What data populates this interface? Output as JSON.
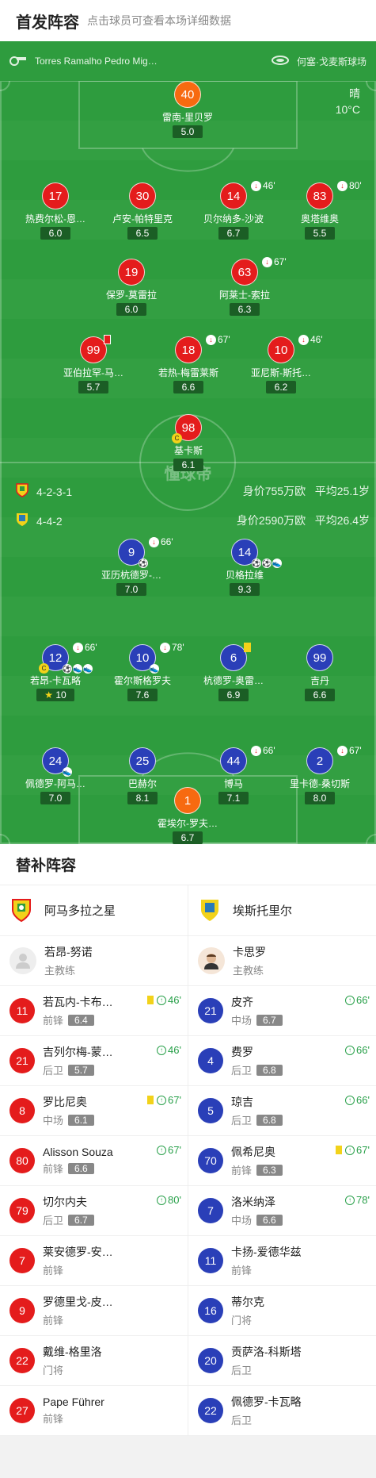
{
  "header": {
    "title": "首发阵容",
    "hint": "点击球员可查看本场详细数据"
  },
  "pitch": {
    "referee": "Torres Ramalho Pedro Mig…",
    "stadium": "何塞·戈麦斯球场",
    "weather": "晴",
    "temperature": "10°C",
    "watermark": "懂球帝",
    "home_formation": "4-2-3-1",
    "home_value": "身价755万欧",
    "home_age": "平均25.1岁",
    "away_formation": "4-4-2",
    "away_value": "身价2590万欧",
    "away_age": "平均26.4岁",
    "home_players": [
      {
        "num": "40",
        "name": "雷南-里贝罗",
        "rating": "5.0"
      },
      {
        "num": "17",
        "name": "热费尔松-恩…",
        "rating": "6.0"
      },
      {
        "num": "30",
        "name": "卢安-帕特里克",
        "rating": "6.5"
      },
      {
        "num": "14",
        "name": "贝尔纳多-沙波",
        "rating": "6.7",
        "sub": "46'"
      },
      {
        "num": "83",
        "name": "奥塔维奥",
        "rating": "5.5",
        "sub": "80'"
      },
      {
        "num": "19",
        "name": "保罗-莫雷拉",
        "rating": "6.0"
      },
      {
        "num": "63",
        "name": "阿莱士-索拉",
        "rating": "6.3",
        "sub": "67'"
      },
      {
        "num": "99",
        "name": "亚伯拉罕-马…",
        "rating": "5.7"
      },
      {
        "num": "18",
        "name": "若热-梅雷莱斯",
        "rating": "6.6",
        "sub": "67'"
      },
      {
        "num": "10",
        "name": "亚尼斯-斯托…",
        "rating": "6.2",
        "sub": "46'"
      },
      {
        "num": "98",
        "name": "基卡斯",
        "rating": "6.1"
      }
    ],
    "away_players": [
      {
        "num": "9",
        "name": "亚历杭德罗-…",
        "rating": "7.0",
        "sub": "66'"
      },
      {
        "num": "14",
        "name": "贝格拉维",
        "rating": "9.3"
      },
      {
        "num": "12",
        "name": "若昂-卡瓦略",
        "rating": "10",
        "sub": "66'"
      },
      {
        "num": "10",
        "name": "霍尔斯格罗夫",
        "rating": "7.6",
        "sub": "78'"
      },
      {
        "num": "6",
        "name": "杭德罗-奥雷…",
        "rating": "6.9"
      },
      {
        "num": "99",
        "name": "吉丹",
        "rating": "6.6"
      },
      {
        "num": "24",
        "name": "佩德罗-阿马…",
        "rating": "7.0"
      },
      {
        "num": "25",
        "name": "巴赫尔",
        "rating": "8.1"
      },
      {
        "num": "44",
        "name": "博马",
        "rating": "7.1",
        "sub": "66'"
      },
      {
        "num": "2",
        "name": "里卡德-桑切斯",
        "rating": "8.0",
        "sub": "67'"
      },
      {
        "num": "1",
        "name": "霍埃尔-罗夫…",
        "rating": "6.7"
      }
    ]
  },
  "subs": {
    "title": "替补阵容",
    "home": {
      "team": "阿马多拉之星",
      "coach": {
        "name": "若昂-努诺",
        "role": "主教练"
      },
      "players": [
        {
          "num": "11",
          "name": "若瓦内-卡布…",
          "pos": "前锋",
          "rating": "6.4",
          "sub": "46'",
          "yellow": true
        },
        {
          "num": "21",
          "name": "吉列尔梅-蒙…",
          "pos": "后卫",
          "rating": "5.7",
          "sub": "46'"
        },
        {
          "num": "8",
          "name": "罗比尼奥",
          "pos": "中场",
          "rating": "6.1",
          "sub": "67'",
          "yellow": true
        },
        {
          "num": "80",
          "name": "Alisson Souza",
          "pos": "前锋",
          "rating": "6.6",
          "sub": "67'"
        },
        {
          "num": "79",
          "name": "切尔内夫",
          "pos": "后卫",
          "rating": "6.7",
          "sub": "80'"
        },
        {
          "num": "7",
          "name": "莱安德罗-安…",
          "pos": "前锋"
        },
        {
          "num": "9",
          "name": "罗德里戈-皮…",
          "pos": "前锋"
        },
        {
          "num": "22",
          "name": "戴维-格里洛",
          "pos": "门将"
        },
        {
          "num": "27",
          "name": "Pape Führer",
          "pos": "前锋"
        }
      ]
    },
    "away": {
      "team": "埃斯托里尔",
      "coach": {
        "name": "卡思罗",
        "role": "主教练"
      },
      "players": [
        {
          "num": "21",
          "name": "皮齐",
          "pos": "中场",
          "rating": "6.7",
          "sub": "66'"
        },
        {
          "num": "4",
          "name": "费罗",
          "pos": "后卫",
          "rating": "6.8",
          "sub": "66'"
        },
        {
          "num": "5",
          "name": "琼吉",
          "pos": "后卫",
          "rating": "6.8",
          "sub": "66'"
        },
        {
          "num": "70",
          "name": "佩希尼奥",
          "pos": "前锋",
          "rating": "6.3",
          "sub": "67'",
          "yellow": true
        },
        {
          "num": "7",
          "name": "洛米纳泽",
          "pos": "中场",
          "rating": "6.6",
          "sub": "78'"
        },
        {
          "num": "11",
          "name": "卡扬-爱德华兹",
          "pos": "前锋"
        },
        {
          "num": "16",
          "name": "蒂尔克",
          "pos": "门将"
        },
        {
          "num": "20",
          "name": "贡萨洛-科斯塔",
          "pos": "后卫"
        },
        {
          "num": "22",
          "name": "佩德罗-卡瓦略",
          "pos": "后卫"
        }
      ]
    }
  }
}
